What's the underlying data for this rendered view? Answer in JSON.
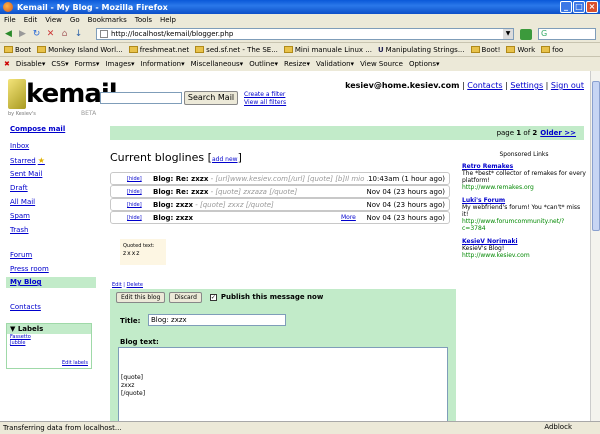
{
  "window": {
    "title": "Kemail - My Blog - Mozilla Firefox"
  },
  "menu": [
    "File",
    "Edit",
    "View",
    "Go",
    "Bookmarks",
    "Tools",
    "Help"
  ],
  "url": "http://localhost/kemail/blogger.php",
  "search_engine": "G",
  "bookmarks": [
    "Boot",
    "Monkey Island Worl...",
    "freshmeat.net",
    "sed.sf.net - The SE...",
    "Mini manuale Linux ...",
    "Manipulating Strings...",
    "Boot!",
    "Work",
    "foo"
  ],
  "devbar": [
    "Disable▾",
    "CSS▾",
    "Forms▾",
    "Images▾",
    "Information▾",
    "Miscellaneous▾",
    "Outline▾",
    "Resize▾",
    "Validation▾",
    "View Source",
    "Options▾"
  ],
  "status": {
    "text": "Transferring data from localhost...",
    "adblock": "Adblock"
  },
  "logo": {
    "word": "kemail",
    "tagline": "by Kesiev's",
    "beta": "BETA"
  },
  "search": {
    "button": "Search Mail",
    "create_filter": "Create a filter",
    "view_filters": "View all filters"
  },
  "user": {
    "email": "kesiev@home.kesiev.com",
    "contacts": "Contacts",
    "settings": "Settings",
    "signout": "Sign out"
  },
  "pager": {
    "text": "page",
    "current": "1",
    "of": "of",
    "total": "2",
    "older": "Older >>"
  },
  "sidebar": {
    "compose": "Compose mail",
    "items": [
      "Inbox",
      "Starred",
      "Sent Mail",
      "Draft",
      "All Mail",
      "Spam",
      "Trash",
      "Forum",
      "Press room",
      "My Blog",
      "Contacts"
    ]
  },
  "labels": {
    "title": "Labels",
    "items": [
      "Fassetto",
      "Jubble"
    ],
    "edit": "Edit labels"
  },
  "main": {
    "title": "Current bloglines",
    "add_new": "add new"
  },
  "threads": [
    {
      "hide": "[hide]",
      "subject": "Blog: Re: zxzx",
      "snippet": " - [url]www.kesiev.com[/url] [quote] [b]Il mio ...",
      "time": "10:43am (1 hour ago)"
    },
    {
      "hide": "[hide]",
      "subject": "Blog: Re: zxzx",
      "snippet": " - [quote] zxzaza [/quote]",
      "time": "Nov 04 (23 hours ago)"
    },
    {
      "hide": "[hide]",
      "subject": "Blog: zxzx",
      "snippet": " - [quote] zxxz [/quote]",
      "time": "Nov 04 (23 hours ago)"
    },
    {
      "hide": "[hide]",
      "subject": "Blog: zxzx",
      "snippet": "",
      "more": "More",
      "time": "Nov 04 (23 hours ago)"
    }
  ],
  "quoted": {
    "label": "Quoted text:",
    "body": "zxxz"
  },
  "message_actions": {
    "edit": "Edit",
    "delete": "Delete"
  },
  "compose": {
    "edit_button": "Edit this blog",
    "discard_button": "Discard",
    "publish_label": "Publish this message now",
    "title_label": "Title:",
    "title_value": "Blog: zxzx",
    "body_label": "Blog text:",
    "body_value": "[quote]\nzxxz\n[/quote]"
  },
  "sponsored": {
    "title": "Sponsored Links",
    "ads": [
      {
        "title": "Retro Remakes",
        "desc": "The *best* collector of remakes for every platform!",
        "url": "http://www.remakes.org"
      },
      {
        "title": "Luki's Forum",
        "desc": "My webfriend's forum! You *can't* miss it!",
        "url": "http://www.forumcommunity.net/?c=3784"
      },
      {
        "title": "KesieV Norimaki",
        "desc": "KesieV's Blog!",
        "url": "http://www.kesiev.com"
      }
    ]
  }
}
